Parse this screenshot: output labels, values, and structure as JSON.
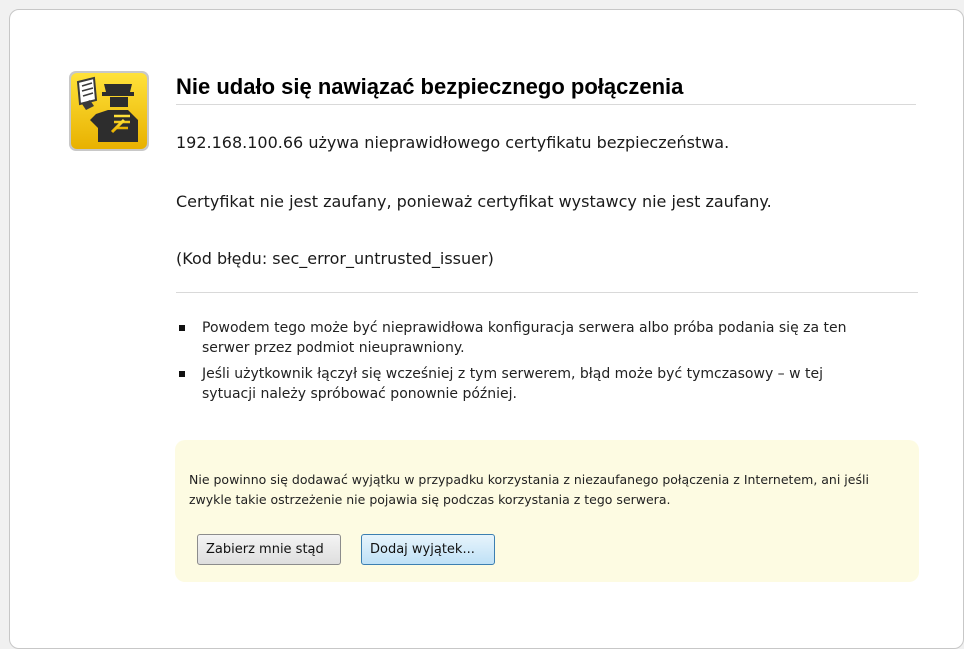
{
  "error_page": {
    "title": "Nie udało się nawiązać bezpiecznego połączenia",
    "host_line": "192.168.100.66 używa nieprawidłowego certyfikatu bezpieczeństwa.",
    "reason_line": "Certyfikat nie jest zaufany, ponieważ certyfikat wystawcy nie jest zaufany.",
    "error_code_line": "(Kod błędu: sec_error_untrusted_issuer)",
    "icon": "security-officer-warning-icon",
    "bullets": [
      "Powodem tego może być nieprawidłowa konfiguracja serwera albo próba podania się za ten serwer przez podmiot nieuprawniony.",
      "Jeśli użytkownik łączył się wcześniej z tym serwerem, błąd może być tymczasowy – w tej sytuacji należy spróbować ponownie później."
    ]
  },
  "advisory": {
    "text": "Nie powinno się dodawać wyjątku w przypadku korzystania z niezaufanego połączenia z Internetem, ani jeśli zwykle takie ostrzeżenie nie pojawia się podczas korzystania z tego serwera.",
    "get_me_out_label": "Zabierz mnie stąd",
    "add_exception_label": "Dodaj wyjątek..."
  },
  "colors": {
    "icon_yellow": "#f5c400",
    "advisory_background": "#fdfbe2",
    "primary_button": "#bfe1f6"
  }
}
